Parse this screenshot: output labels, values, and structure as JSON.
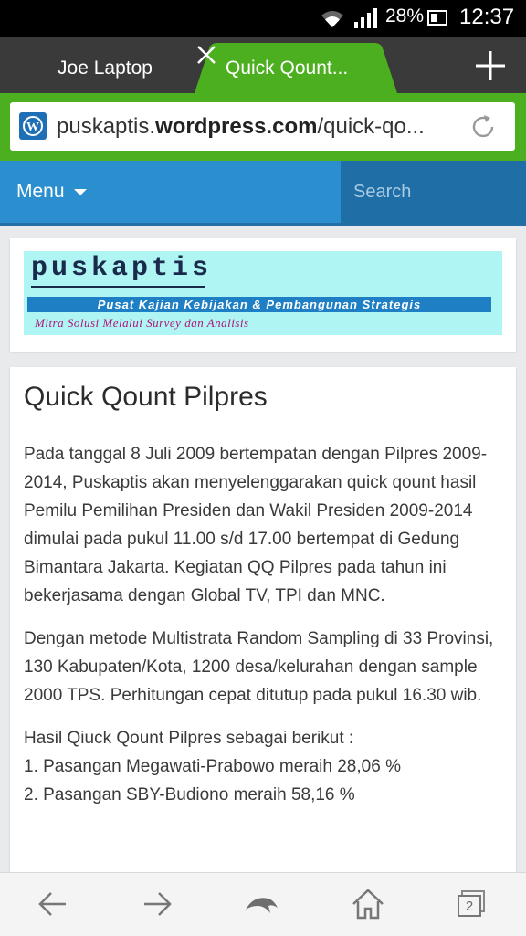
{
  "status_bar": {
    "battery_percent": "28%",
    "time": "12:37"
  },
  "tabs": [
    {
      "label": "Joe Laptop",
      "active": false
    },
    {
      "label": "Quick Qount...",
      "active": true
    }
  ],
  "address_bar": {
    "url_prefix": "puskaptis.",
    "url_domain": "wordpress.com",
    "url_suffix": "/quick-qo..."
  },
  "site_header": {
    "menu_label": "Menu",
    "search_placeholder": "Search"
  },
  "logo": {
    "title": "puskaptis",
    "subtitle": "Pusat Kajian Kebijakan & Pembangunan Strategis",
    "tagline": "Mitra Solusi Melalui Survey dan Analisis"
  },
  "post": {
    "title": "Quick Qount Pilpres",
    "paragraph_1": "Pada tanggal 8 Juli 2009 bertempatan dengan Pilpres 2009-2014, Puskaptis akan menyelenggarakan quick qount hasil Pemilu Pemilihan Presiden dan Wakil Presiden 2009-2014 dimulai pada pukul 11.00 s/d 17.00 bertempat di Gedung Bimantara Jakarta. Kegiatan QQ Pilpres pada tahun ini bekerjasama dengan Global TV, TPI dan MNC.",
    "paragraph_2": "Dengan metode Multistrata Random Sampling di 33 Provinsi, 130 Kabupaten/Kota, 1200 desa/kelurahan dengan sample 2000 TPS. Perhitungan cepat ditutup pada pukul 16.30 wib.",
    "results_intro": "Hasil Qiuck Qount Pilpres sebagai berikut :",
    "results": [
      "1. Pasangan Megawati-Prabowo meraih 28,06 %",
      "2. Pasangan SBY-Budiono meraih 58,16 %"
    ]
  },
  "bottom_nav": {
    "tab_count": "2"
  },
  "colors": {
    "accent_green": "#4caf1f",
    "site_blue": "#2b8fcf",
    "search_blue": "#1f6ea6"
  }
}
